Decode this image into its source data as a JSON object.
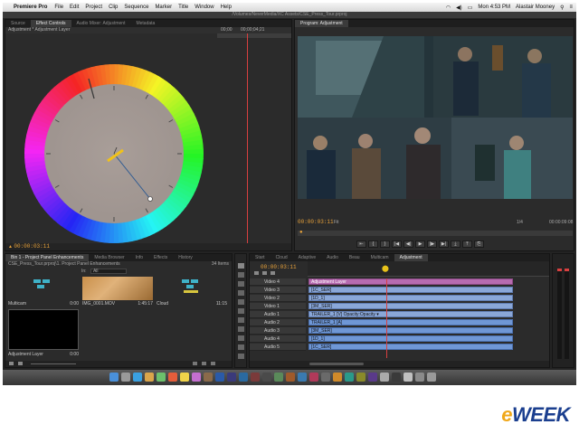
{
  "menubar": {
    "app": "Premiere Pro",
    "items": [
      "File",
      "Edit",
      "Project",
      "Clip",
      "Sequence",
      "Marker",
      "Title",
      "Window",
      "Help"
    ],
    "clock": "Mon 4:53 PM",
    "user": "Alastair Mooney"
  },
  "path": "/Volumes/NeverMedia/XC Assets/CSE_Press_Tour.prproj",
  "source_panel": {
    "tabs": [
      "Source",
      "Effect Controls",
      "Audio Mixer: Adjustment",
      "Metadata"
    ],
    "active_tab": "Effect Controls",
    "subheader": "Adjustment * Adjustment Layer",
    "ruler_start": "00;00",
    "ruler_end": "00;00;04;21",
    "timecode": "00:00:03:11"
  },
  "program_panel": {
    "tab": "Program: Adjustment",
    "timecode_left": "00:00:03:11",
    "fit": "Fit",
    "zoom": "1/4",
    "timecode_right": "00:00:09:08",
    "transport": [
      "⇤",
      "{",
      "}",
      "|◀",
      "◀|",
      "▶",
      "|▶",
      "▶|",
      "⤓",
      "⤒",
      "⎘"
    ]
  },
  "project_panel": {
    "tabs": [
      "Bin 1 - Project Panel Enhancements",
      "Media Browser",
      "Info",
      "Effects",
      "History"
    ],
    "path": "CSE_Press_Tour.prproj\\1. Project Panel Enhancements",
    "items_count": "34 Items",
    "in_label": "In:",
    "in_value": "All",
    "items": [
      {
        "name": "Multicam",
        "duration": "0:00"
      },
      {
        "name": "IMG_0001.MOV",
        "duration": "1:45:17"
      },
      {
        "name": "Cloud",
        "duration": "11:15"
      },
      {
        "name": "Adjustment Layer",
        "duration": "0:00"
      }
    ]
  },
  "timeline_panel": {
    "tabs": [
      "Start",
      "Cloud",
      "Adaptive",
      "Audio",
      "Beau",
      "Multicam",
      "Adjustment"
    ],
    "active_tab": "Adjustment",
    "timecode": "00:00:03:11",
    "tracks": [
      {
        "name": "Video 4",
        "clip": "Adjustment Layer",
        "kind": "adj"
      },
      {
        "name": "Video 3",
        "clip": "[1C_SER]",
        "kind": "v"
      },
      {
        "name": "Video 2",
        "clip": "[1D_1]",
        "kind": "v"
      },
      {
        "name": "Video 1",
        "clip": "[3M_SER]",
        "kind": "v"
      },
      {
        "name": "Audio 1",
        "clip": "TRAILER_1 [V] Opacity:Opacity ▾",
        "kind": "v"
      },
      {
        "name": "Audio 2",
        "clip": "TRAILER_1 [A]",
        "kind": "a"
      },
      {
        "name": "Audio 3",
        "clip": "[3M_SER]",
        "kind": "a"
      },
      {
        "name": "Audio 4",
        "clip": "[1D_1]",
        "kind": "a"
      },
      {
        "name": "Audio 5",
        "clip": "[1C_SER]",
        "kind": "a"
      }
    ]
  },
  "colors": {
    "timecode": "#e8a23a",
    "playhead": "#d84040",
    "adjustment_clip": "#b76bb0",
    "video_clip": "#8aa7d8"
  },
  "watermark": "eWEEK"
}
